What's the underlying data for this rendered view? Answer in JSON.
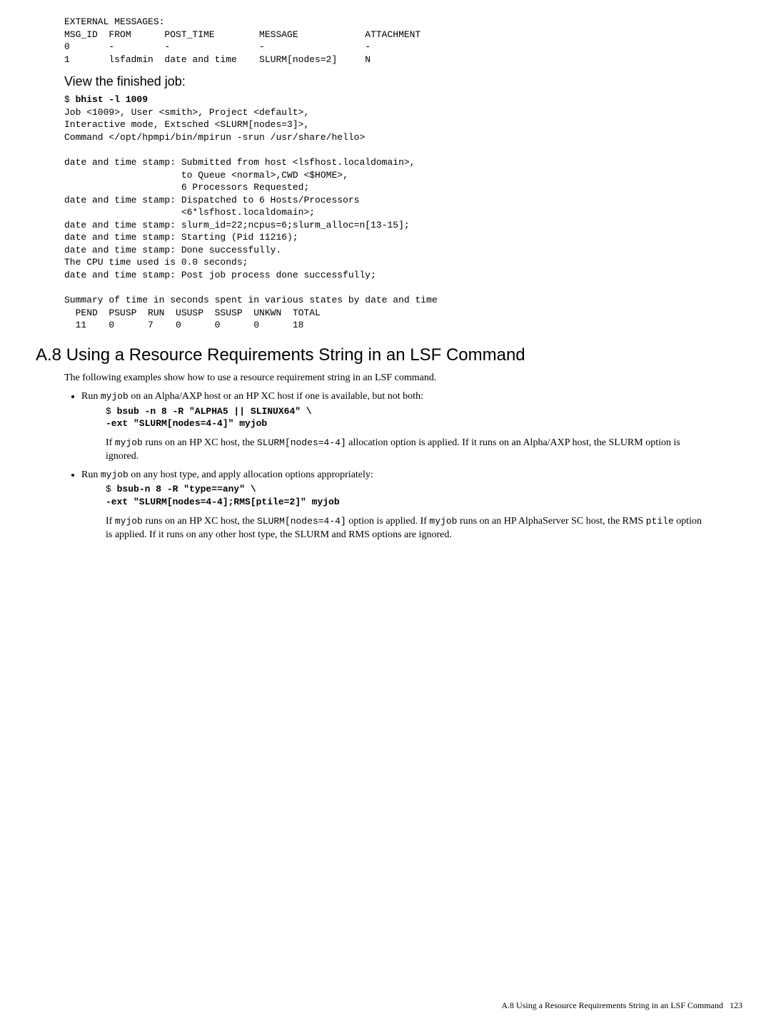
{
  "pre1": "EXTERNAL MESSAGES:\nMSG_ID  FROM      POST_TIME        MESSAGE            ATTACHMENT\n0       -         -                -                  -\n1       lsfadmin  date and time    SLURM[nodes=2]     N",
  "subhead1": "View the finished job:",
  "cmd1_prompt": "$ ",
  "cmd1_bold": "bhist -l 1009",
  "pre2": "Job <1009>, User <smith>, Project <default>,\nInteractive mode, Extsched <SLURM[nodes=3]>,\nCommand </opt/hpmpi/bin/mpirun -srun /usr/share/hello>\n\ndate and time stamp: Submitted from host <lsfhost.localdomain>,\n                     to Queue <normal>,CWD <$HOME>,\n                     6 Processors Requested;\ndate and time stamp: Dispatched to 6 Hosts/Processors\n                     <6*lsfhost.localdomain>;\ndate and time stamp: slurm_id=22;ncpus=6;slurm_alloc=n[13-15];\ndate and time stamp: Starting (Pid 11216);\ndate and time stamp: Done successfully.\nThe CPU time used is 0.0 seconds;\ndate and time stamp: Post job process done successfully;\n\nSummary of time in seconds spent in various states by date and time\n  PEND  PSUSP  RUN  USUSP  SSUSP  UNKWN  TOTAL\n  11    0      7    0      0      0      18",
  "section_title": "A.8 Using a Resource Requirements String in an LSF Command",
  "para1": "The following examples show how to use a resource requirement string in an LSF command.",
  "bullet1_intro_a": "Run ",
  "bullet1_intro_code": "myjob",
  "bullet1_intro_b": " on an Alpha/AXP host or an HP XC host if one is available, but not both:",
  "bullet1_cmd_prompt": "$ ",
  "bullet1_cmd_bold": "bsub -n 8 -R \"ALPHA5 || SLINUX64\" \\\n-ext \"SLURM[nodes=4-4]\" myjob",
  "bullet1_para_a": "If ",
  "bullet1_para_code1": "myjob",
  "bullet1_para_b": " runs on an HP XC host, the ",
  "bullet1_para_code2": "SLURM[nodes=4-4]",
  "bullet1_para_c": " allocation option is applied. If it runs on an Alpha/AXP host, the SLURM option is ignored.",
  "bullet2_intro_a": "Run ",
  "bullet2_intro_code": "myjob",
  "bullet2_intro_b": " on any host type, and apply allocation options appropriately:",
  "bullet2_cmd_prompt": "$ ",
  "bullet2_cmd_bold": "bsub-n 8 -R \"type==any\" \\\n-ext \"SLURM[nodes=4-4];RMS[ptile=2]\" myjob",
  "bullet2_para_a": "If ",
  "bullet2_para_code1": "myjob",
  "bullet2_para_b": " runs on an HP XC host, the ",
  "bullet2_para_code2": "SLURM[nodes=4-4]",
  "bullet2_para_c": " option is applied. If ",
  "bullet2_para_code3": "myjob",
  "bullet2_para_d": " runs on an HP AlphaServer SC host, the RMS ",
  "bullet2_para_code4": "ptile",
  "bullet2_para_e": " option is applied. If it runs on any other host type, the SLURM and RMS options are ignored.",
  "footer_text": "A.8 Using a Resource Requirements String in an LSF Command",
  "footer_page": "123"
}
